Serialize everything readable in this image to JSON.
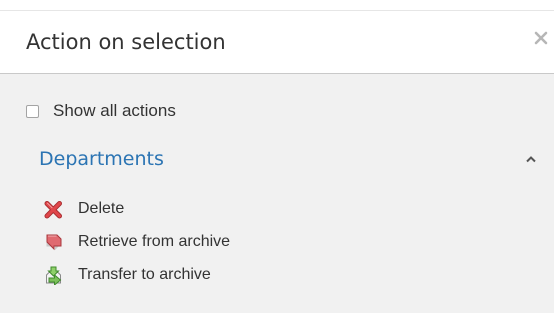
{
  "dialog": {
    "title": "Action on selection",
    "close_icon": "close-icon"
  },
  "options": {
    "show_all_label": "Show all actions",
    "show_all_checked": false
  },
  "section": {
    "title": "Departments",
    "expanded": true,
    "toggle_icon": "chevron-up-icon"
  },
  "actions": [
    {
      "label": "Delete",
      "icon": "delete-icon"
    },
    {
      "label": "Retrieve from archive",
      "icon": "retrieve-archive-icon"
    },
    {
      "label": "Transfer to archive",
      "icon": "transfer-archive-icon"
    }
  ],
  "colors": {
    "link": "#2b74b3",
    "delete": "#e0464a",
    "retrieve": "#e06a70",
    "transfer": "#7cc05a"
  }
}
